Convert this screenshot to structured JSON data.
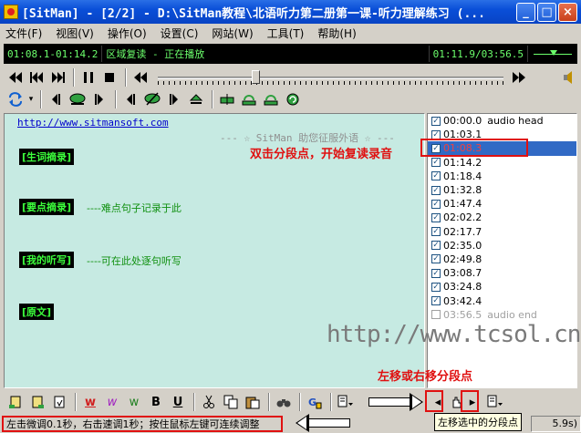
{
  "window": {
    "title": "[SitMan] - [2/2] - D:\\SitMan教程\\北语听力第二册第一课-听力理解练习 (...",
    "minimize": "_",
    "maximize": "□",
    "close": "×"
  },
  "menu": [
    "文件(F)",
    "视图(V)",
    "操作(O)",
    "设置(C)",
    "网站(W)",
    "工具(T)",
    "帮助(H)"
  ],
  "status_strip": {
    "range": "01:08.1-01:14.2",
    "mode": "区域复读 - 正在播放",
    "position": "01:11.9/03:56.5"
  },
  "transport": {
    "position_fraction": 0.27
  },
  "text_area": {
    "url": "http://www.sitmansoft.com",
    "banner": "--- ☆ SitMan 助您征服外语 ☆ ---",
    "sections": [
      {
        "tag": "[生词摘录]",
        "hint": ""
      },
      {
        "tag": "[要点摘录]",
        "hint": "----难点句子记录于此"
      },
      {
        "tag": "[我的听写]",
        "hint": "----可在此处逐句听写"
      },
      {
        "tag": "[原文]",
        "hint": ""
      }
    ]
  },
  "segments": [
    {
      "time": "00:00.0",
      "label": "audio head",
      "checked": true,
      "selected": false,
      "disabled": false
    },
    {
      "time": "01:03.1",
      "label": "",
      "checked": true,
      "selected": false,
      "disabled": false
    },
    {
      "time": "01:08.3",
      "label": "",
      "checked": true,
      "selected": true,
      "disabled": false
    },
    {
      "time": "01:14.2",
      "label": "",
      "checked": true,
      "selected": false,
      "disabled": false
    },
    {
      "time": "01:18.4",
      "label": "",
      "checked": true,
      "selected": false,
      "disabled": false
    },
    {
      "time": "01:32.8",
      "label": "",
      "checked": true,
      "selected": false,
      "disabled": false
    },
    {
      "time": "01:47.4",
      "label": "",
      "checked": true,
      "selected": false,
      "disabled": false
    },
    {
      "time": "02:02.2",
      "label": "",
      "checked": true,
      "selected": false,
      "disabled": false
    },
    {
      "time": "02:17.7",
      "label": "",
      "checked": true,
      "selected": false,
      "disabled": false
    },
    {
      "time": "02:35.0",
      "label": "",
      "checked": true,
      "selected": false,
      "disabled": false
    },
    {
      "time": "02:49.8",
      "label": "",
      "checked": true,
      "selected": false,
      "disabled": false
    },
    {
      "time": "03:08.7",
      "label": "",
      "checked": true,
      "selected": false,
      "disabled": false
    },
    {
      "time": "03:24.8",
      "label": "",
      "checked": true,
      "selected": false,
      "disabled": false
    },
    {
      "time": "03:42.4",
      "label": "",
      "checked": true,
      "selected": false,
      "disabled": false
    },
    {
      "time": "03:56.5",
      "label": "audio end",
      "checked": false,
      "selected": false,
      "disabled": true
    }
  ],
  "annotations": {
    "double_click": "双击分段点，开始复读录音",
    "move_segment": "左移或右移分段点",
    "watermark": "http://www.tcsol.cn"
  },
  "bottom_toolbar": {
    "bold": "B",
    "underline": "U",
    "color_w": "w",
    "seg_left": "◂",
    "seg_right": "▸"
  },
  "statusbar": {
    "hint": "左击微调0.1秒，右击速调1秒；按住鼠标左键可连续调整",
    "tooltip": "左移选中的分段点",
    "duration": "5.9s)"
  },
  "colors": {
    "accent_red": "#e01010",
    "text_bg": "#c6eae2",
    "lcd_green": "#6cff6c"
  }
}
